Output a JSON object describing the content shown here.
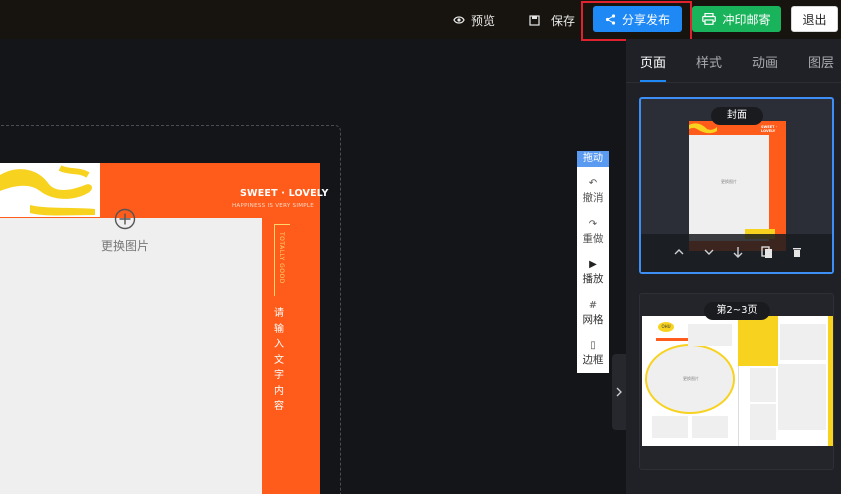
{
  "topbar": {
    "preview_label": "预览",
    "save_label": "保存",
    "share_label": "分享发布",
    "print_label": "冲印邮寄",
    "exit_label": "退出"
  },
  "canvas": {
    "brand_title": "SWEET · LOVELY",
    "brand_subtitle": "HAPPINESS IS VERY SIMPLE",
    "bracket_text": "TOTALLY GOOD",
    "replace_photo_label": "更换图片",
    "vertical_text": [
      "请",
      "输",
      "入",
      "文",
      "字",
      "内",
      "容"
    ]
  },
  "tools": {
    "drag_label": "拖动",
    "items": [
      {
        "icon": "undo-icon",
        "label": "撤消"
      },
      {
        "icon": "redo-icon",
        "label": "重做"
      },
      {
        "icon": "play-icon",
        "label": "播放"
      },
      {
        "icon": "grid-icon",
        "label": "网格"
      },
      {
        "icon": "border-icon",
        "label": "边框"
      }
    ]
  },
  "panel": {
    "tabs": [
      "页面",
      "样式",
      "动画",
      "图层"
    ],
    "active_tab": "页面",
    "pages": [
      {
        "label": "封面",
        "selected": true,
        "photo_label": "更换图片",
        "mini_brand": "SWEET · LOVELY"
      },
      {
        "label": "第2~3页",
        "selected": false,
        "photo_label": "更换图片",
        "mini_badge": "OHU"
      }
    ]
  },
  "colors": {
    "accent": "#1e88f5",
    "print_green": "#19b35c",
    "page_orange": "#ff5c1b",
    "highlight_red": "#e0212e"
  }
}
